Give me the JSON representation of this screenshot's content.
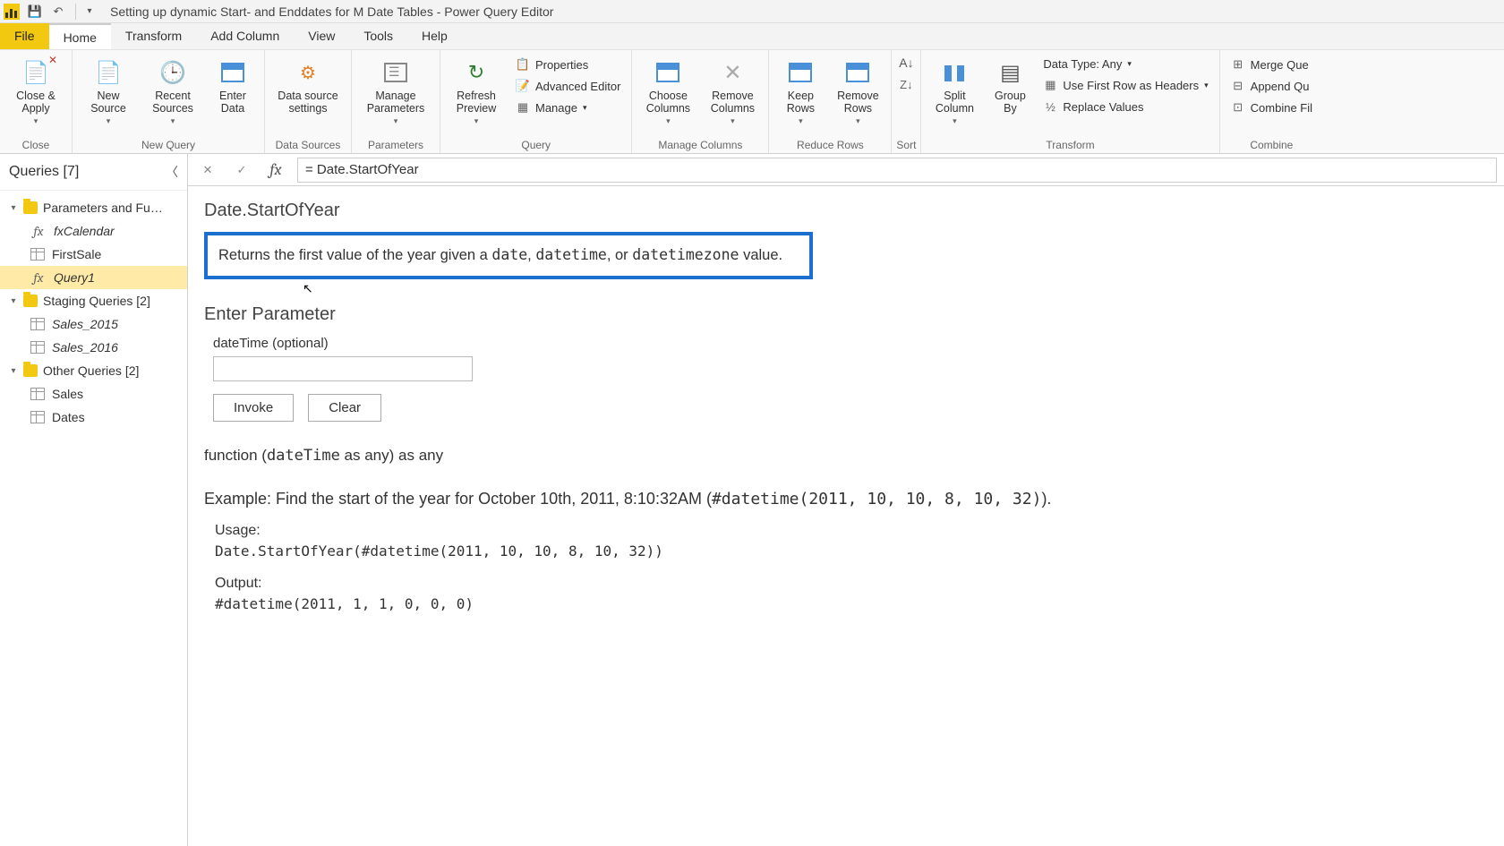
{
  "window": {
    "title": "Setting up dynamic Start- and Enddates for M Date Tables - Power Query Editor"
  },
  "tabs": {
    "file": "File",
    "home": "Home",
    "transform": "Transform",
    "add_column": "Add Column",
    "view": "View",
    "tools": "Tools",
    "help": "Help"
  },
  "ribbon": {
    "close": {
      "close_apply": "Close &\nApply",
      "label": "Close"
    },
    "new_query": {
      "new_source": "New\nSource",
      "recent": "Recent\nSources",
      "enter_data": "Enter\nData",
      "label": "New Query"
    },
    "data_sources": {
      "settings": "Data source\nsettings",
      "label": "Data Sources"
    },
    "parameters": {
      "manage": "Manage\nParameters",
      "label": "Parameters"
    },
    "query": {
      "refresh": "Refresh\nPreview",
      "properties": "Properties",
      "advanced": "Advanced Editor",
      "manage": "Manage",
      "label": "Query"
    },
    "manage_cols": {
      "choose": "Choose\nColumns",
      "remove": "Remove\nColumns",
      "label": "Manage Columns"
    },
    "reduce_rows": {
      "keep": "Keep\nRows",
      "remove": "Remove\nRows",
      "label": "Reduce Rows"
    },
    "sort": {
      "label": "Sort"
    },
    "transform": {
      "split": "Split\nColumn",
      "group": "Group\nBy",
      "datatype": "Data Type: Any",
      "first_row": "Use First Row as Headers",
      "replace": "Replace Values",
      "label": "Transform"
    },
    "combine": {
      "merge": "Merge Que",
      "append": "Append Qu",
      "combine_files": "Combine Fil",
      "label": "Combine"
    }
  },
  "queries_pane": {
    "header": "Queries [7]",
    "groups": [
      {
        "name": "Parameters and Fu…",
        "items": [
          {
            "label": "fxCalendar",
            "icon": "fx",
            "italic": true
          },
          {
            "label": "FirstSale",
            "icon": "tbl"
          },
          {
            "label": "Query1",
            "icon": "fx",
            "italic": true,
            "selected": true
          }
        ]
      },
      {
        "name": "Staging Queries [2]",
        "items": [
          {
            "label": "Sales_2015",
            "icon": "tbl",
            "italic": true
          },
          {
            "label": "Sales_2016",
            "icon": "tbl",
            "italic": true
          }
        ]
      },
      {
        "name": "Other Queries [2]",
        "items": [
          {
            "label": "Sales",
            "icon": "tbl"
          },
          {
            "label": "Dates",
            "icon": "tbl"
          }
        ]
      }
    ]
  },
  "formula_bar": "= Date.StartOfYear",
  "content": {
    "func_name": "Date.StartOfYear",
    "description_pre": "Returns the first value of the year given a ",
    "code_date": "date",
    "sep1": ", ",
    "code_datetime": "datetime",
    "sep2": ", or ",
    "code_dtz": "datetimezone",
    "description_post": " value.",
    "enter_param": "Enter Parameter",
    "param_label": "dateTime (optional)",
    "invoke": "Invoke",
    "clear": "Clear",
    "sig_pre": "function (",
    "sig_code": "dateTime",
    "sig_post": " as any) as any",
    "example_pre": "Example: Find the start of the year for October 10th, 2011, 8:10:32AM (",
    "example_code": "#datetime(2011, 10, 10, 8, 10, 32)",
    "example_post": ").",
    "usage_label": "Usage:",
    "usage_code": "Date.StartOfYear(#datetime(2011, 10, 10, 8, 10, 32))",
    "output_label": "Output:",
    "output_code": "#datetime(2011, 1, 1, 0, 0, 0)"
  }
}
